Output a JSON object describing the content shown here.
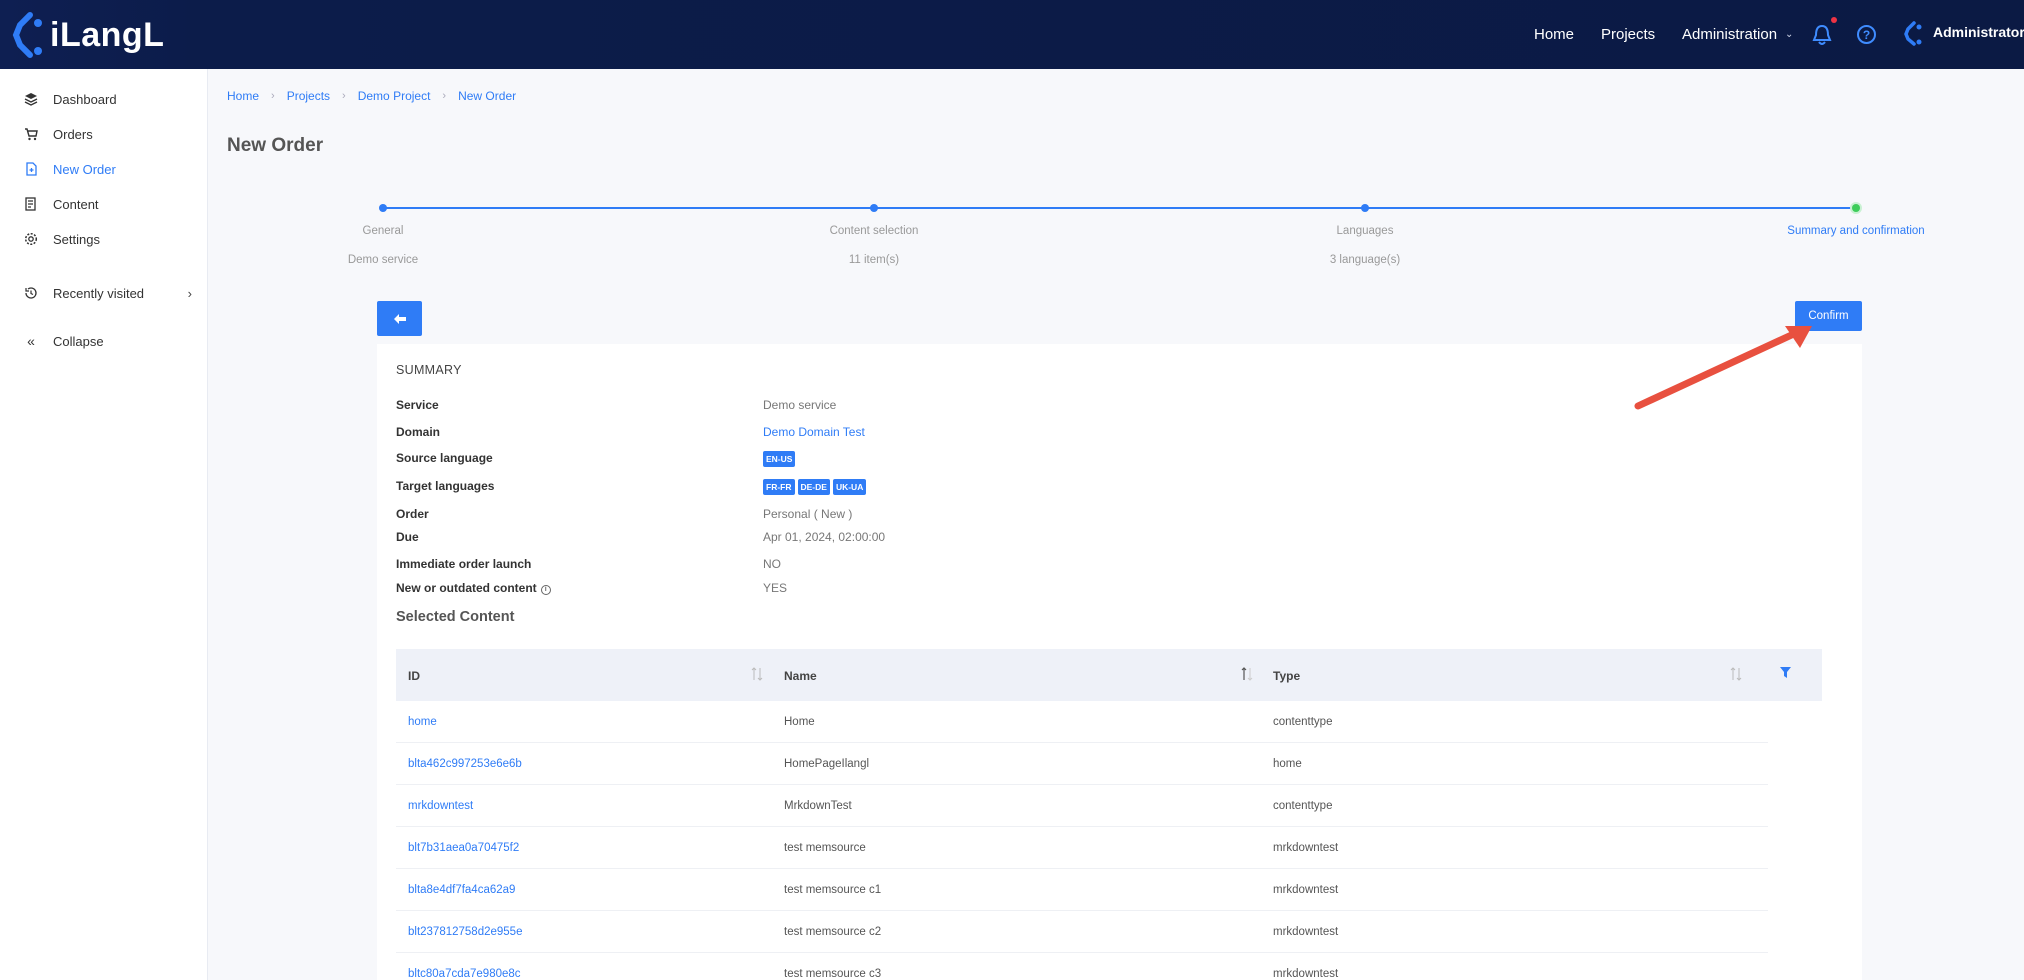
{
  "brand": {
    "name": "iLangL"
  },
  "topnav": {
    "home": "Home",
    "projects": "Projects",
    "administration": "Administration",
    "user": "Administrator"
  },
  "sidebar": {
    "items": [
      {
        "label": "Dashboard",
        "icon": "layers-icon"
      },
      {
        "label": "Orders",
        "icon": "cart-icon"
      },
      {
        "label": "New Order",
        "icon": "new-document-icon",
        "active": true
      },
      {
        "label": "Content",
        "icon": "content-icon"
      },
      {
        "label": "Settings",
        "icon": "gear-icon"
      },
      {
        "label": "Recently visited",
        "icon": "history-icon"
      },
      {
        "label": "Collapse",
        "icon": "double-chevron-left-icon"
      }
    ]
  },
  "breadcrumb": [
    "Home",
    "Projects",
    "Demo Project",
    "New Order"
  ],
  "page_title": "New Order",
  "stepper": [
    {
      "label": "General",
      "sub": "Demo service"
    },
    {
      "label": "Content selection",
      "sub": "11 item(s)"
    },
    {
      "label": "Languages",
      "sub": "3 language(s)"
    },
    {
      "label": "Summary and confirmation",
      "sub": ""
    }
  ],
  "confirm_label": "Confirm",
  "summary": {
    "title": "SUMMARY",
    "service_label": "Service",
    "service": "Demo service",
    "domain_label": "Domain",
    "domain": "Demo Domain Test",
    "source_label": "Source language",
    "source": "EN-US",
    "target_label": "Target languages",
    "targets": [
      "FR-FR",
      "DE-DE",
      "UK-UA"
    ],
    "order_label": "Order",
    "order": "Personal ( New )",
    "due_label": "Due",
    "due": "Apr 01, 2024, 02:00:00",
    "immediate_label": "Immediate order launch",
    "immediate": "NO",
    "outdated_label": "New or outdated content",
    "outdated": "YES"
  },
  "selected_content": {
    "title": "Selected Content",
    "columns": [
      "ID",
      "Name",
      "Type"
    ],
    "rows": [
      {
        "id": "home",
        "name": "Home",
        "type": "contenttype"
      },
      {
        "id": "blta462c997253e6e6b",
        "name": "HomePageIlangl",
        "type": "home"
      },
      {
        "id": "mrkdowntest",
        "name": "MrkdownTest",
        "type": "contenttype"
      },
      {
        "id": "blt7b31aea0a70475f2",
        "name": "test memsource",
        "type": "mrkdowntest"
      },
      {
        "id": "blta8e4df7fa4ca62a9",
        "name": "test memsource c1",
        "type": "mrkdowntest"
      },
      {
        "id": "blt237812758d2e955e",
        "name": "test memsource c2",
        "type": "mrkdowntest"
      },
      {
        "id": "bltc80a7cda7e980e8c",
        "name": "test memsource c3",
        "type": "mrkdowntest"
      }
    ]
  },
  "colors": {
    "accent": "#2f7cf6",
    "topbar": "#0b1a44",
    "success": "#3dcd5a",
    "annotation": "#e8503f"
  }
}
